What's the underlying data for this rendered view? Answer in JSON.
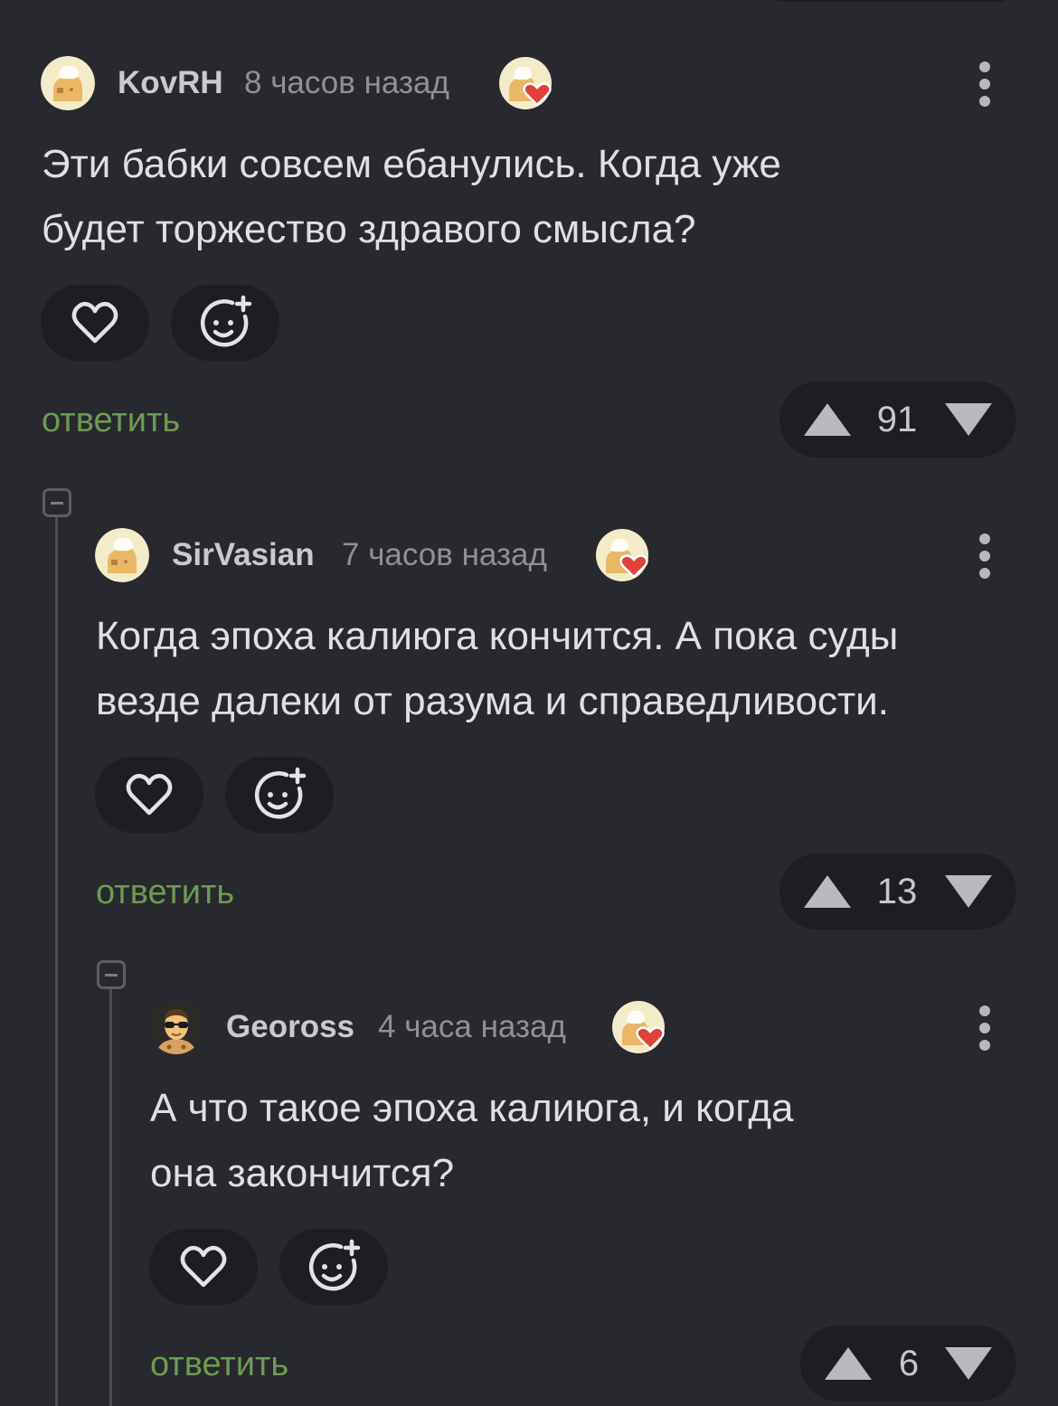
{
  "colors": {
    "background": "#27292e",
    "button_bg": "#1c1e22",
    "reply_link": "#6f9a52",
    "heart_badge": "#e0413a"
  },
  "icons": {
    "like": "heart-outline-icon",
    "reaction": "smiley-plus-icon",
    "badge": "heart-badge-icon",
    "more": "vertical-dots-icon",
    "upvote": "triangle-up-icon",
    "downvote": "triangle-down-icon",
    "collapse": "minus-square-icon"
  },
  "comments": [
    {
      "username": "KovRH",
      "time": "8 часов назад",
      "text_lines": [
        "Эти бабки совсем ебанулись. Когда уже",
        "будет торжество здравого смысла?"
      ],
      "reply_label": "ответить",
      "score": "91"
    },
    {
      "username": "SirVasian",
      "time": "7 часов назад",
      "text_lines": [
        "Когда эпоха калиюга кончится. А пока суды",
        "везде далеки от разума и справедливости."
      ],
      "reply_label": "ответить",
      "score": "13"
    },
    {
      "username": "Geoross",
      "time": "4 часа назад",
      "text_lines": [
        "А что такое эпоха калиюга, и когда",
        "она закончится?"
      ],
      "reply_label": "ответить",
      "score": "6"
    }
  ]
}
